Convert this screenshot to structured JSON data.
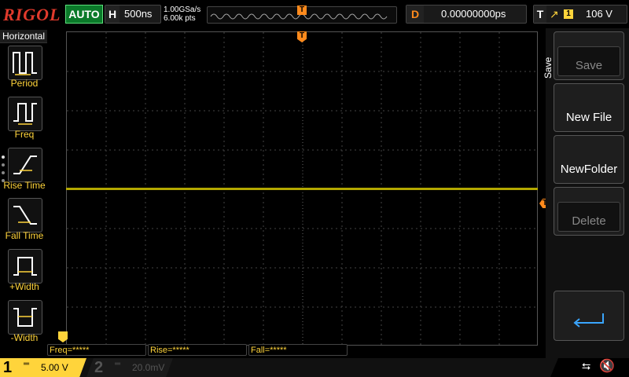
{
  "top": {
    "logo": "RIGOL",
    "run_state": "AUTO",
    "h_letter": "H",
    "h_timebase": "500ns",
    "sample_rate": "1.00GSa/s",
    "mem_depth": "6.00k pts",
    "trigger_marker": "T",
    "d_letter": "D",
    "delay": "0.00000000ps",
    "t_letter": "T",
    "trig_channel": "1",
    "trig_level": "106 V"
  },
  "left_panel": {
    "title": "Horizontal",
    "items": [
      {
        "label": "Period",
        "icon": "period-icon"
      },
      {
        "label": "Freq",
        "icon": "frequency-icon"
      },
      {
        "label": "Rise Time",
        "icon": "rise-time-icon"
      },
      {
        "label": "Fall Time",
        "icon": "fall-time-icon"
      },
      {
        "label": "+Width",
        "icon": "positive-width-icon"
      },
      {
        "label": "-Width",
        "icon": "negative-width-icon"
      }
    ]
  },
  "right_menu": {
    "title": "Save",
    "buttons": [
      {
        "label": "Save",
        "enabled": false
      },
      {
        "label": "New File",
        "enabled": true
      },
      {
        "label": "NewFolder",
        "enabled": true
      },
      {
        "label": "Delete",
        "enabled": false
      }
    ],
    "return_icon": "return-arrow-icon"
  },
  "measurements": {
    "freq": "Freq=*****",
    "rise": "Rise=*****",
    "fall": "Fall=*****"
  },
  "channels": {
    "ch1_num": "1",
    "ch1_scale": "5.00 V",
    "ch2_num": "2",
    "ch2_scale": "20.0mV"
  },
  "colors": {
    "ch1": "#ffd43b",
    "trace": "#b3a800",
    "trigger": "#ff8a1c",
    "run_green": "#0b7a2a",
    "logo_red": "#e03a2c"
  }
}
